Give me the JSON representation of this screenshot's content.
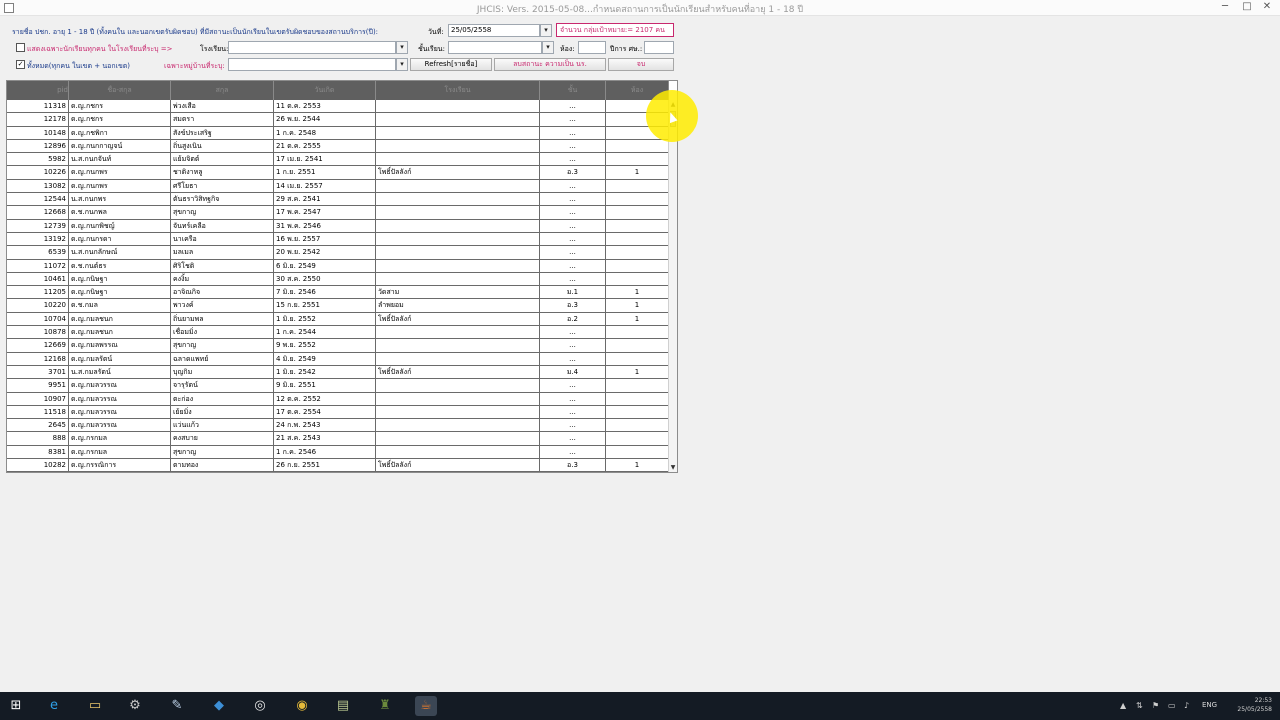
{
  "window": {
    "title": "JHCIS: Vers. 2015-05-08...กำหนดสถานการเป็นนักเรียนสำหรับคนที่อายุ 1 - 18 ปี",
    "minimize": "─",
    "maximize": "□",
    "close": "✕"
  },
  "form": {
    "heading": "รายชื่อ ปชก. อายุ 1 - 18 ปี (ทั้งคนใน และนอกเขตรับผิดชอบ) ที่มีสถานะเป็นนักเรียนในเขตรับผิดชอบของสถานบริการ(ปี):",
    "date_label": "วันที่:",
    "date_value": "25/05/2558",
    "count_text": "จำนวน กลุ่มเป้าหมาย:= 2107 คน",
    "check_school_label": "แสดงเฉพาะนักเรียนทุกคน ในโรงเรียนที่ระบุ =>",
    "school_label": "โรงเรียน:",
    "school_value": "",
    "grade_label": "ชั้นเรียน:",
    "grade_value": "",
    "room_label": "ห้อง:",
    "room_value": "",
    "year_label": "ปีการ ศษ.:",
    "year_value": "",
    "check_all_label": "ทั้งหมด(ทุกคน ในเขต + นอกเขต)",
    "check_all_checked": "✓",
    "village_label": "เฉพาะหมู่บ้านที่ระบุ:",
    "village_value": "",
    "refresh_button": "Refresh[รายชื่อ]",
    "status_button": "ลบสถานะ ความเป็น นร.",
    "close_button": "จบ",
    "dropdown_arrow": "▾"
  },
  "grid": {
    "columns": [
      "pid",
      "ชื่อ-สกุล",
      "สกุล",
      "วันเกิด",
      "โรงเรียน",
      "ชั้น",
      "ห้อง"
    ],
    "rows": [
      [
        "11318",
        "ด.ญ.กชกร",
        "พ่วงเสือ",
        "11 ต.ค. 2553",
        "",
        "...",
        ""
      ],
      [
        "12178",
        "ด.ญ.กชกร",
        "สมตรา",
        "26 พ.ย. 2544",
        "",
        "...",
        ""
      ],
      [
        "10148",
        "ด.ญ.กชพิกา",
        "สังข์ประเสริฐ",
        "1 ก.ค. 2548",
        "",
        "...",
        ""
      ],
      [
        "12896",
        "ด.ญ.กนกกาญจน์",
        "ถิ่นสูงเนิน",
        "21 ต.ค. 2555",
        "",
        "...",
        ""
      ],
      [
        "5982",
        "น.ส.กนกจันท์",
        "แย้มจิตต์",
        "17 เม.ย. 2541",
        "",
        "...",
        ""
      ],
      [
        "10226",
        "ด.ญ.กนกพร",
        "ชาติงาหลู",
        "1 ก.ย. 2551",
        "โพธิ์ปัลลังก์",
        "อ.3",
        "1"
      ],
      [
        "13082",
        "ด.ญ.กนกพร",
        "ศรีโยธา",
        "14 เม.ย. 2557",
        "",
        "...",
        ""
      ],
      [
        "12544",
        "น.ส.กนกพร",
        "ตันธราวิสิทฐกิจ",
        "29 ส.ค. 2541",
        "",
        "...",
        ""
      ],
      [
        "12668",
        "ด.ช.กนกพล",
        "สุขกาญ",
        "17 พ.ค. 2547",
        "",
        "...",
        ""
      ],
      [
        "12739",
        "ด.ญ.กนกพิชญ์",
        "จันทร์เคลือ",
        "31 พ.ค. 2546",
        "",
        "...",
        ""
      ],
      [
        "13192",
        "ด.ญ.กนกรดา",
        "นาเครือ",
        "16 พ.ย. 2557",
        "",
        "...",
        ""
      ],
      [
        "6539",
        "น.ส.กนกลักษณ์",
        "มลเมล",
        "20 พ.ย. 2542",
        "",
        "...",
        ""
      ],
      [
        "11072",
        "ด.ช.กนต์ธร",
        "ศิริโชติ",
        "6 มิ.ย. 2549",
        "",
        "...",
        ""
      ],
      [
        "10461",
        "ด.ญ.กนิษฐา",
        "คงงิ้ม",
        "30 ส.ค. 2550",
        "",
        "...",
        ""
      ],
      [
        "11205",
        "ด.ญ.กนิษฐา",
        "อาจิณกิจ",
        "7 มิ.ย. 2546",
        "วัดสาม",
        "ม.1",
        "1"
      ],
      [
        "10220",
        "ด.ช.กมล",
        "พาวงค์",
        "15 ก.ย. 2551",
        "ลำพยอม",
        "อ.3",
        "1"
      ],
      [
        "10704",
        "ด.ญ.กมลชนก",
        "ถิ่นยามพล",
        "1 มิ.ย. 2552",
        "โพธิ์ปัลลังก์",
        "อ.2",
        "1"
      ],
      [
        "10878",
        "ด.ญ.กมลชนก",
        "เชื่อมมิ่ง",
        "1 ก.ค. 2544",
        "",
        "...",
        ""
      ],
      [
        "12669",
        "ด.ญ.กมลพรรณ",
        "สุขกาญ",
        "9 พ.ย. 2552",
        "",
        "...",
        ""
      ],
      [
        "12168",
        "ด.ญ.กมลรัตน์",
        "ฉลาดแพทย์",
        "4 มิ.ย. 2549",
        "",
        "...",
        ""
      ],
      [
        "3701",
        "น.ส.กมลรัตน์",
        "บุญกิม",
        "1 มิ.ย. 2542",
        "โพธิ์ปัลลังก์",
        "ม.4",
        "1"
      ],
      [
        "9951",
        "ด.ญ.กมลวรรณ",
        "จารุรัตน์",
        "9 มิ.ย. 2551",
        "",
        "...",
        ""
      ],
      [
        "10907",
        "ด.ญ.กมลวรรณ",
        "ตะก่อง",
        "12 ต.ค. 2552",
        "",
        "...",
        ""
      ],
      [
        "11518",
        "ด.ญ.กมลวรรณ",
        "เย้ยมิ่ง",
        "17 ต.ค. 2554",
        "",
        "...",
        ""
      ],
      [
        "2645",
        "ด.ญ.กมลวรรณ",
        "แว่นแก้ว",
        "24 ก.พ. 2543",
        "",
        "...",
        ""
      ],
      [
        "888",
        "ด.ญ.กรกมล",
        "คงสบาย",
        "21 ส.ค. 2543",
        "",
        "...",
        ""
      ],
      [
        "8381",
        "ด.ญ.กรกมล",
        "สุขกาญ",
        "1 ก.ค. 2546",
        "",
        "...",
        ""
      ],
      [
        "10282",
        "ด.ญ.กรรณิการ",
        "ตามทอง",
        "26 ก.ย. 2551",
        "โพธิ์ปัลลังก์",
        "อ.3",
        "1"
      ]
    ]
  },
  "scroll": {
    "up": "▲",
    "down": "▼"
  },
  "taskbar": {
    "icons": [
      {
        "name": "windows-start-icon",
        "glyph": "⊞",
        "color": "#ffffff"
      },
      {
        "name": "internet-explorer-icon",
        "glyph": "e",
        "color": "#2e9fe6"
      },
      {
        "name": "file-explorer-icon",
        "glyph": "▭",
        "color": "#e8c46a"
      },
      {
        "name": "app-gear-icon",
        "glyph": "⚙",
        "color": "#c9c9c9"
      },
      {
        "name": "app-pen-icon",
        "glyph": "✎",
        "color": "#bcd0e6"
      },
      {
        "name": "app-blue-icon",
        "glyph": "◆",
        "color": "#3d8fd6"
      },
      {
        "name": "app-ring-icon",
        "glyph": "◎",
        "color": "#e6e6e6"
      },
      {
        "name": "chrome-icon",
        "glyph": "◉",
        "color": "#e4b93a"
      },
      {
        "name": "app-green-icon",
        "glyph": "▤",
        "color": "#b7c48f"
      },
      {
        "name": "app-figure-icon",
        "glyph": "♜",
        "color": "#6b8a3c"
      },
      {
        "name": "java-app-icon",
        "glyph": "☕",
        "color": "#e27b2e"
      }
    ],
    "lang": "ENG",
    "time": "22:53",
    "date": "25/05/2558"
  }
}
